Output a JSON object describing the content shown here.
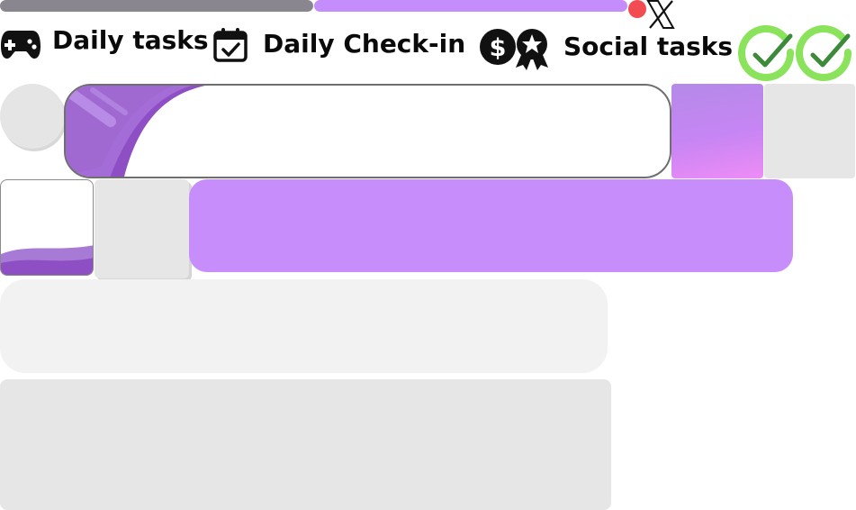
{
  "header": {
    "progress": [
      {
        "name": "progress-gray",
        "color": "#8a8690",
        "fill": 1.0
      },
      {
        "name": "progress-purple",
        "color": "#c58dfc",
        "fill": 1.0
      }
    ],
    "notification_dot_color": "#f24b52",
    "close_icon": "x-icon"
  },
  "sections": {
    "daily_tasks": {
      "label": "Daily tasks",
      "icon": "gamepad-icon"
    },
    "daily_checkin": {
      "label": "Daily Check-in",
      "icon": "calendar-check-icon"
    },
    "social_tasks": {
      "label": "Social tasks",
      "icons": [
        "dollar-coin-icon",
        "medal-icon"
      ]
    }
  },
  "status": {
    "check_icons": [
      "check-circle-icon",
      "check-circle-icon"
    ],
    "check_color": "#8ae35b"
  },
  "colors": {
    "accent_purple": "#c68dfb",
    "dark_purple": "#8f4fc4",
    "placeholder_gray": "#e6e6e6",
    "light_gray": "#f2f2f2",
    "text": "#0a0a0a"
  }
}
